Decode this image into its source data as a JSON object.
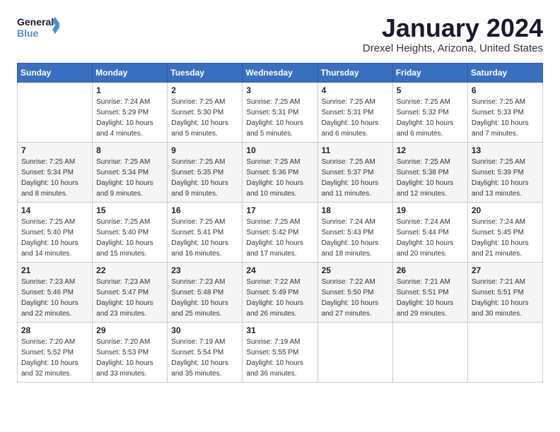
{
  "logo": {
    "line1": "General",
    "line2": "Blue"
  },
  "title": "January 2024",
  "subtitle": "Drexel Heights, Arizona, United States",
  "header": {
    "accent_color": "#3a6fbf"
  },
  "days_of_week": [
    "Sunday",
    "Monday",
    "Tuesday",
    "Wednesday",
    "Thursday",
    "Friday",
    "Saturday"
  ],
  "weeks": [
    [
      {
        "num": "",
        "info": ""
      },
      {
        "num": "1",
        "info": "Sunrise: 7:24 AM\nSunset: 5:29 PM\nDaylight: 10 hours\nand 4 minutes."
      },
      {
        "num": "2",
        "info": "Sunrise: 7:25 AM\nSunset: 5:30 PM\nDaylight: 10 hours\nand 5 minutes."
      },
      {
        "num": "3",
        "info": "Sunrise: 7:25 AM\nSunset: 5:31 PM\nDaylight: 10 hours\nand 5 minutes."
      },
      {
        "num": "4",
        "info": "Sunrise: 7:25 AM\nSunset: 5:31 PM\nDaylight: 10 hours\nand 6 minutes."
      },
      {
        "num": "5",
        "info": "Sunrise: 7:25 AM\nSunset: 5:32 PM\nDaylight: 10 hours\nand 6 minutes."
      },
      {
        "num": "6",
        "info": "Sunrise: 7:25 AM\nSunset: 5:33 PM\nDaylight: 10 hours\nand 7 minutes."
      }
    ],
    [
      {
        "num": "7",
        "info": "Sunrise: 7:25 AM\nSunset: 5:34 PM\nDaylight: 10 hours\nand 8 minutes."
      },
      {
        "num": "8",
        "info": "Sunrise: 7:25 AM\nSunset: 5:34 PM\nDaylight: 10 hours\nand 9 minutes."
      },
      {
        "num": "9",
        "info": "Sunrise: 7:25 AM\nSunset: 5:35 PM\nDaylight: 10 hours\nand 9 minutes."
      },
      {
        "num": "10",
        "info": "Sunrise: 7:25 AM\nSunset: 5:36 PM\nDaylight: 10 hours\nand 10 minutes."
      },
      {
        "num": "11",
        "info": "Sunrise: 7:25 AM\nSunset: 5:37 PM\nDaylight: 10 hours\nand 11 minutes."
      },
      {
        "num": "12",
        "info": "Sunrise: 7:25 AM\nSunset: 5:38 PM\nDaylight: 10 hours\nand 12 minutes."
      },
      {
        "num": "13",
        "info": "Sunrise: 7:25 AM\nSunset: 5:39 PM\nDaylight: 10 hours\nand 13 minutes."
      }
    ],
    [
      {
        "num": "14",
        "info": "Sunrise: 7:25 AM\nSunset: 5:40 PM\nDaylight: 10 hours\nand 14 minutes."
      },
      {
        "num": "15",
        "info": "Sunrise: 7:25 AM\nSunset: 5:40 PM\nDaylight: 10 hours\nand 15 minutes."
      },
      {
        "num": "16",
        "info": "Sunrise: 7:25 AM\nSunset: 5:41 PM\nDaylight: 10 hours\nand 16 minutes."
      },
      {
        "num": "17",
        "info": "Sunrise: 7:25 AM\nSunset: 5:42 PM\nDaylight: 10 hours\nand 17 minutes."
      },
      {
        "num": "18",
        "info": "Sunrise: 7:24 AM\nSunset: 5:43 PM\nDaylight: 10 hours\nand 18 minutes."
      },
      {
        "num": "19",
        "info": "Sunrise: 7:24 AM\nSunset: 5:44 PM\nDaylight: 10 hours\nand 20 minutes."
      },
      {
        "num": "20",
        "info": "Sunrise: 7:24 AM\nSunset: 5:45 PM\nDaylight: 10 hours\nand 21 minutes."
      }
    ],
    [
      {
        "num": "21",
        "info": "Sunrise: 7:23 AM\nSunset: 5:46 PM\nDaylight: 10 hours\nand 22 minutes."
      },
      {
        "num": "22",
        "info": "Sunrise: 7:23 AM\nSunset: 5:47 PM\nDaylight: 10 hours\nand 23 minutes."
      },
      {
        "num": "23",
        "info": "Sunrise: 7:23 AM\nSunset: 5:48 PM\nDaylight: 10 hours\nand 25 minutes."
      },
      {
        "num": "24",
        "info": "Sunrise: 7:22 AM\nSunset: 5:49 PM\nDaylight: 10 hours\nand 26 minutes."
      },
      {
        "num": "25",
        "info": "Sunrise: 7:22 AM\nSunset: 5:50 PM\nDaylight: 10 hours\nand 27 minutes."
      },
      {
        "num": "26",
        "info": "Sunrise: 7:21 AM\nSunset: 5:51 PM\nDaylight: 10 hours\nand 29 minutes."
      },
      {
        "num": "27",
        "info": "Sunrise: 7:21 AM\nSunset: 5:51 PM\nDaylight: 10 hours\nand 30 minutes."
      }
    ],
    [
      {
        "num": "28",
        "info": "Sunrise: 7:20 AM\nSunset: 5:52 PM\nDaylight: 10 hours\nand 32 minutes."
      },
      {
        "num": "29",
        "info": "Sunrise: 7:20 AM\nSunset: 5:53 PM\nDaylight: 10 hours\nand 33 minutes."
      },
      {
        "num": "30",
        "info": "Sunrise: 7:19 AM\nSunset: 5:54 PM\nDaylight: 10 hours\nand 35 minutes."
      },
      {
        "num": "31",
        "info": "Sunrise: 7:19 AM\nSunset: 5:55 PM\nDaylight: 10 hours\nand 36 minutes."
      },
      {
        "num": "",
        "info": ""
      },
      {
        "num": "",
        "info": ""
      },
      {
        "num": "",
        "info": ""
      }
    ]
  ]
}
